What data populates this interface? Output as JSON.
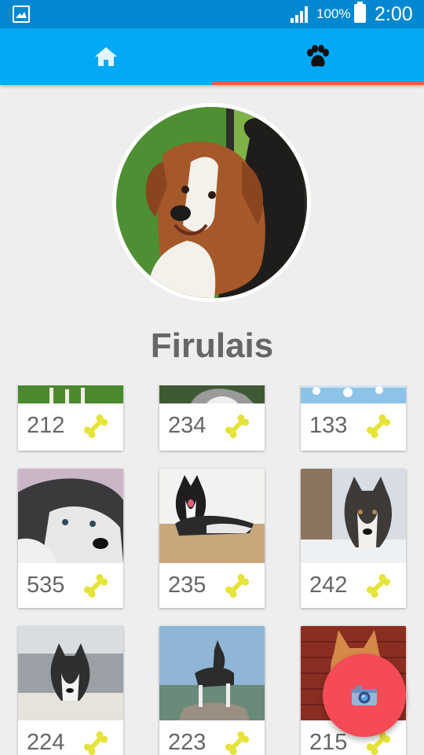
{
  "status_bar": {
    "battery": "100%",
    "time": "2:00"
  },
  "tabs": [
    {
      "icon": "home-icon",
      "active": false
    },
    {
      "icon": "paw-icon",
      "active": true
    }
  ],
  "colors": {
    "status_bar": "#0288d1",
    "app_bar": "#03a9f4",
    "tab_indicator": "#ff5252",
    "fab": "#f44b56",
    "bone": "#e6e33a"
  },
  "profile": {
    "name": "Firulais",
    "photo": "brown-white-dog-photo"
  },
  "gallery": {
    "rows": [
      [
        {
          "count": "212",
          "photo": "dog-on-grass-photo"
        },
        {
          "count": "234",
          "photo": "husky-photo"
        },
        {
          "count": "133",
          "photo": "snow-photo"
        }
      ],
      [
        {
          "count": "535",
          "photo": "husky-lying-photo"
        },
        {
          "count": "235",
          "photo": "husky-on-floor-photo"
        },
        {
          "count": "242",
          "photo": "husky-portrait-photo"
        }
      ],
      [
        {
          "count": "224",
          "photo": "husky-in-snow-photo"
        },
        {
          "count": "223",
          "photo": "husky-on-rock-photo"
        },
        {
          "count": "215",
          "photo": "shiba-brick-wall-photo"
        }
      ]
    ]
  },
  "fab": {
    "icon": "camera-icon"
  }
}
